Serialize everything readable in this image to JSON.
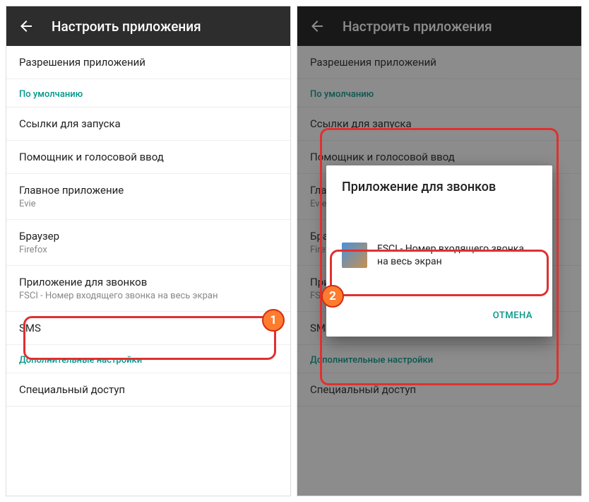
{
  "header": {
    "title": "Настроить приложения"
  },
  "items": {
    "app_permissions": "Разрешения приложений",
    "default_section": "По умолчанию",
    "launch_links": "Ссылки для запуска",
    "assistant_voice": "Помощник и голосовой ввод",
    "main_app_label": "Главное приложение",
    "main_app_value": "Evie",
    "browser_label": "Браузер",
    "browser_value": "Firefox",
    "phone_app_label": "Приложение для звонков",
    "phone_app_value": "FSCI - Номер входящего звонка на весь экран",
    "sms": "SMS",
    "advanced_section": "Дополнительные настройки",
    "special_access": "Специальный доступ"
  },
  "dialog": {
    "title": "Приложение для звонков",
    "option": "FSCI - Номер входящего звонка на весь экран",
    "cancel": "ОТМЕНА"
  },
  "badges": {
    "one": "1",
    "two": "2"
  }
}
